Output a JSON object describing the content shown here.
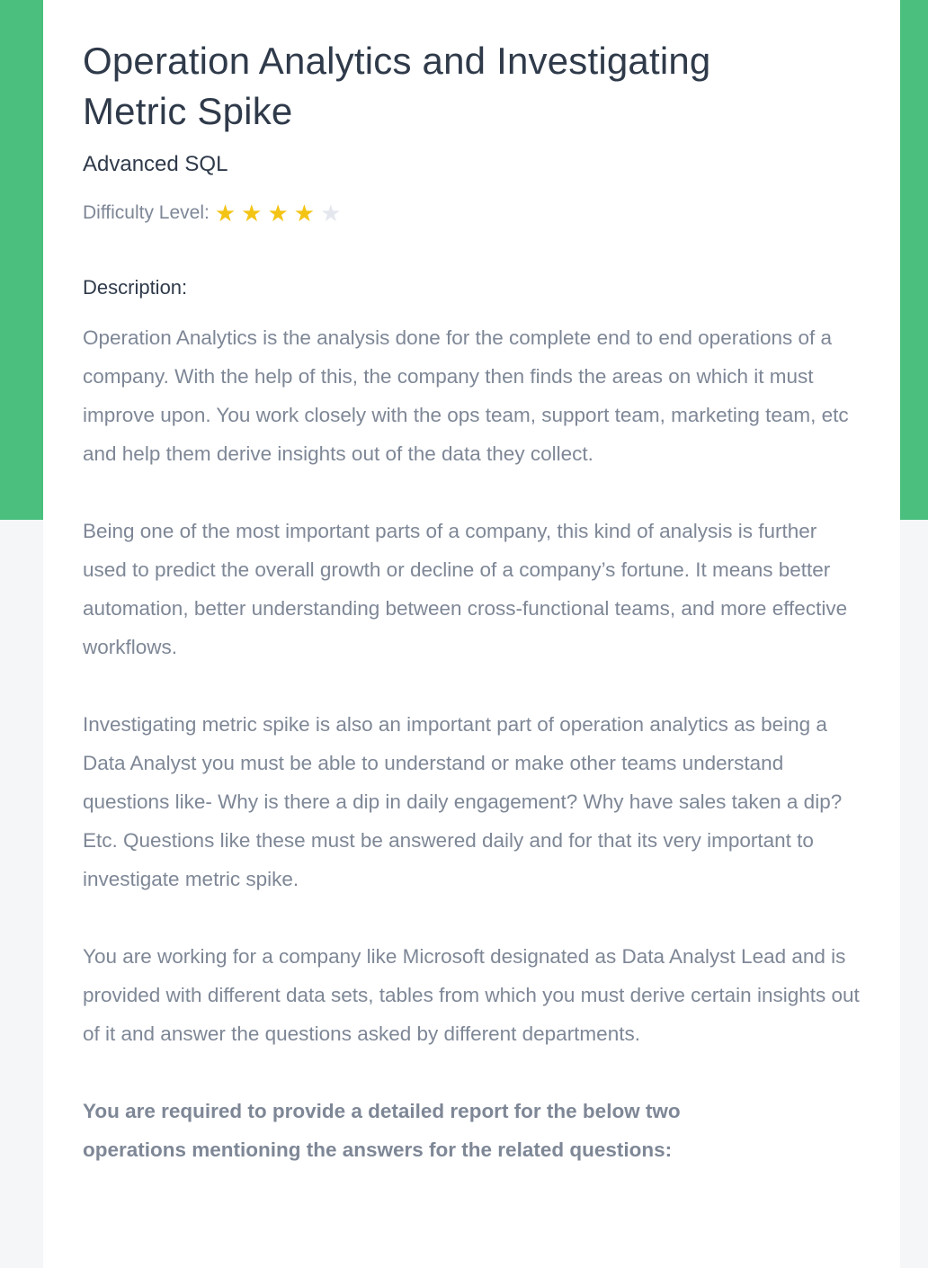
{
  "header": {
    "title": "Operation Analytics and Investigating Metric Spike",
    "subtitle": "Advanced SQL"
  },
  "difficulty": {
    "label": "Difficulty Level:",
    "rating": 4,
    "max": 5,
    "star_icon": "star-icon",
    "colors": {
      "filled": "#f3c414",
      "empty": "#e4e8ee"
    }
  },
  "description": {
    "heading": "Description:",
    "paragraphs": [
      "Operation Analytics is the analysis done for the complete end to end operations of a company. With the help of this, the company then finds the areas on which it must improve upon. You work closely with the ops team, support team, marketing team, etc and help them derive insights out of the data they collect.",
      "Being one of the most important parts of a company, this kind of analysis is further used to predict the overall growth or decline of a company’s fortune. It means better automation, better understanding between cross-functional teams, and more effective workflows.",
      "Investigating metric spike is also an important part of operation analytics as being a Data Analyst you must be able to understand or make other teams understand questions like- Why is there a dip in daily engagement? Why have sales taken a dip? Etc. Questions like these must be answered daily and for that its very important to investigate metric spike.",
      "You are working for a company like Microsoft designated as Data Analyst Lead and is provided with different data sets, tables from which you must derive certain insights out of it and answer the questions asked by different departments."
    ],
    "requirement": "You are required to provide a detailed report for the below two operations mentioning the answers for the related questions:"
  },
  "theme": {
    "accent": "#4bbf7e"
  }
}
